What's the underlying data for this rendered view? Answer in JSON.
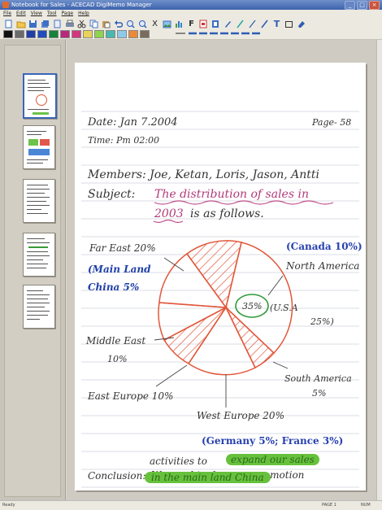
{
  "window": {
    "title": "Notebook for Sales - ACECAD DigiMemo Manager",
    "min": "_",
    "max": "□",
    "close": "×"
  },
  "menu": [
    "File",
    "Edit",
    "View",
    "Tool",
    "Page",
    "Help"
  ],
  "toolbar": {
    "icons": [
      "new-page-icon",
      "open-folder-icon",
      "save-icon",
      "save-all-icon",
      "page-icon",
      "print-icon",
      "cut-icon",
      "copy-icon",
      "paste-icon",
      "undo-icon",
      "zoom-in-icon",
      "zoom-out-icon",
      "delete-icon",
      "image-icon",
      "chart-icon",
      "font-icon",
      "export-icon",
      "pdf-icon",
      "pen-icon",
      "thin-pen-icon",
      "medium-pen-icon",
      "thick-pen-icon",
      "text-tool-icon",
      "rectangle-icon",
      "eraser-icon"
    ],
    "text_tool": "T",
    "font_tool": "F",
    "delete_tool": "X",
    "colors": [
      "#111111",
      "#6b6b6b",
      "#1f3fa8",
      "#224bbd",
      "#17823a",
      "#b8297c",
      "#d1387f",
      "#e9d25a",
      "#8fd44d",
      "#49b9b0",
      "#8ecae8",
      "#e98a3b",
      "#7a6c5d"
    ]
  },
  "note": {
    "date": "Date: Jan 7.2004",
    "time": "Time: Pm 02:00",
    "page": "Page- 58",
    "members": "Members: Joe, Ketan, Loris, Jason, Antti",
    "subject_label": "Subject:",
    "subject_line1": "The distribution of sales in",
    "subject_line2_year": "2003",
    "subject_line2_rest": "is as follows.",
    "label_far_east": "Far East 20%",
    "label_mainland": "(Main Land",
    "label_china": "China 5%",
    "label_canada": "(Canada 10%)",
    "label_north_america": "North America",
    "label_35": "35%",
    "label_usa": "(U.S.A",
    "label_25": "25%)",
    "label_middle_east": "Middle East",
    "label_middle_east_pct": "10%",
    "label_east_europe": "East Europe 10%",
    "label_south_america": "South America",
    "label_south_america_pct": "5%",
    "label_west_europe": "West Europe 20%",
    "label_germany": "(Germany 5%; France 3%)",
    "conclusion_label": "Conclusion:",
    "conclusion_l1": "We need to do more promotion",
    "conclusion_l2a": "activities to",
    "conclusion_l2b": "expand our sales",
    "conclusion_l3": "in the main land China"
  },
  "status": {
    "left": "Ready",
    "page": "PAGE 1",
    "mode": "NUM"
  }
}
